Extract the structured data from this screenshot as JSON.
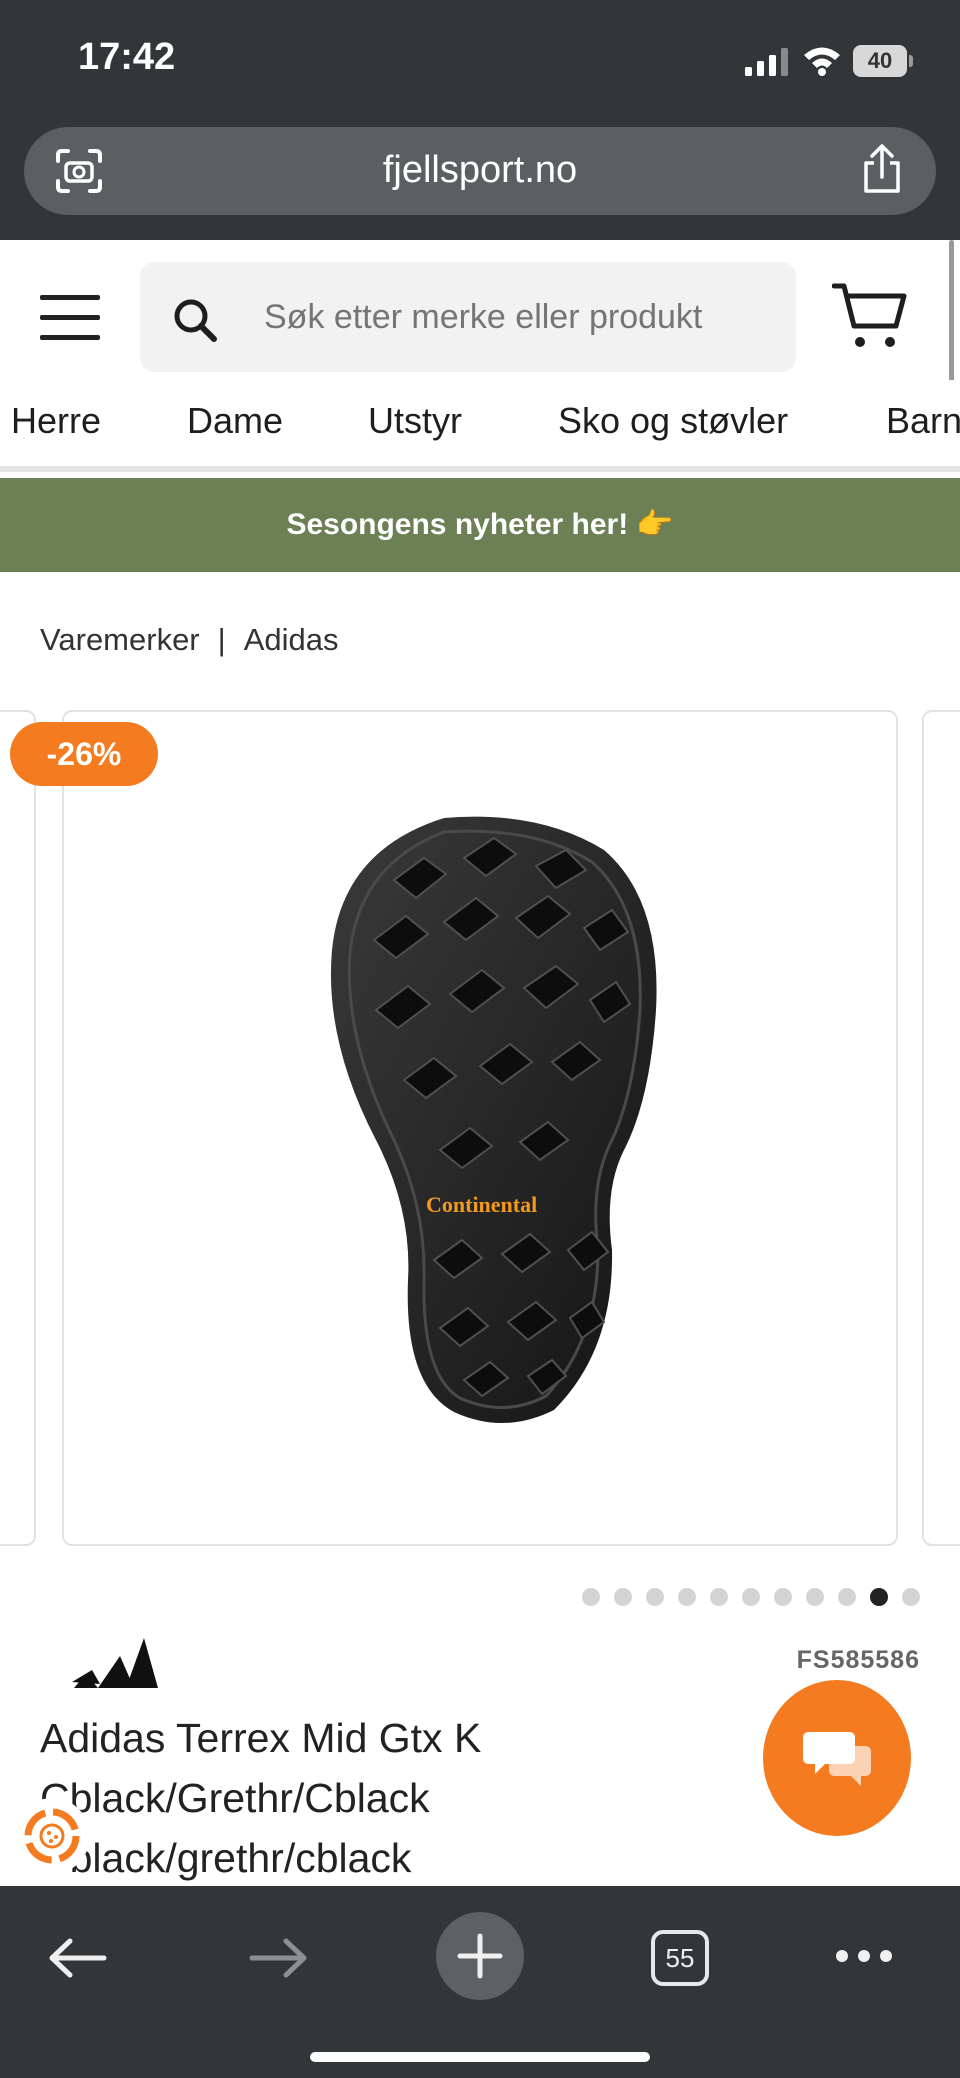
{
  "status_bar": {
    "time": "17:42",
    "battery": "40"
  },
  "browser": {
    "url": "fjellsport.no",
    "open_tabs": "55"
  },
  "header": {
    "search_placeholder": "Søk etter merke eller produkt"
  },
  "nav": {
    "items": [
      "Herre",
      "Dame",
      "Utstyr",
      "Sko og støvler",
      "Barn"
    ]
  },
  "promo": {
    "text": "Sesongens nyheter her!",
    "emoji": "👉"
  },
  "breadcrumb": {
    "parent": "Varemerker",
    "separator": "|",
    "current": "Adidas"
  },
  "gallery": {
    "discount_badge": "-26%",
    "sole_brand": "Continental",
    "slide_count": 11,
    "active_slide": 10
  },
  "product": {
    "sku": "FS585586",
    "title_lines": [
      "Adidas Terrex Mid Gtx K",
      "Cblack/Grethr/Cblack",
      "Cblack/grethr/cblack"
    ]
  },
  "colors": {
    "accent": "#f47b20",
    "promo_bg": "#6d7f55",
    "browser_chrome": "#333638"
  },
  "icons": [
    "camera-search-icon",
    "share-icon",
    "menu-icon",
    "search-icon",
    "cart-icon",
    "chat-icon",
    "cookie-icon",
    "back-arrow-icon",
    "forward-arrow-icon",
    "plus-icon",
    "more-icon"
  ]
}
